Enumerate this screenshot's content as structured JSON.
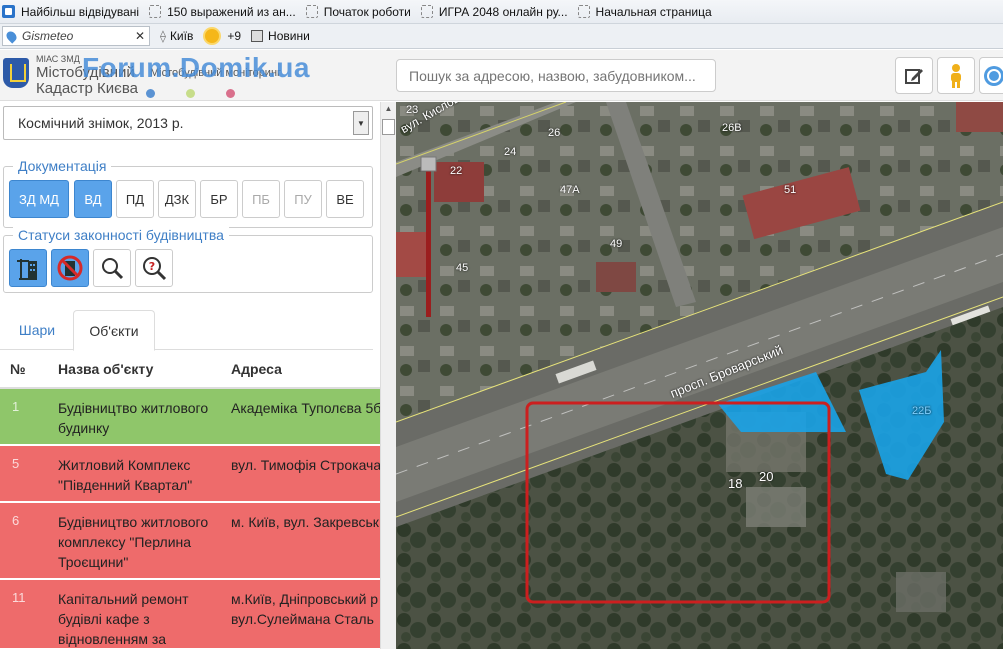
{
  "browser": {
    "bookmarks": [
      "Найбільш відвідувані",
      "150 выражений из ан...",
      "Початок роботи",
      "ИГРА 2048 онлайн ру...",
      "Начальная страница"
    ],
    "gismeteo_label": "Gismeteo",
    "city": "Київ",
    "temperature": "+9",
    "news": "Новини"
  },
  "header": {
    "logo_small": "МІАС ЗМД",
    "logo_line1": "Містобудівний",
    "logo_line2": "Кадастр Києва",
    "logo_sub": "Містобудівний моніторинг",
    "watermark": "Forum.Domik.ua",
    "search_placeholder": "Пошук за адресою, назвою, забудовником...",
    "dot_colors": [
      "#5b93d3",
      "#b9d66a",
      "#d9708c"
    ]
  },
  "layer_select": {
    "value": "Космічний знімок, 2013 р."
  },
  "documentation": {
    "title": "Документація",
    "buttons": [
      {
        "label": "ЗД МД",
        "state": "on"
      },
      {
        "label": "ВД",
        "state": "on"
      },
      {
        "label": "ПД",
        "state": "normal"
      },
      {
        "label": "ДЗК",
        "state": "normal"
      },
      {
        "label": "БР",
        "state": "normal"
      },
      {
        "label": "ПБ",
        "state": "disabled"
      },
      {
        "label": "ПУ",
        "state": "disabled"
      },
      {
        "label": "ВЕ",
        "state": "normal"
      }
    ]
  },
  "statuses": {
    "title": "Статуси законності будівництва",
    "buttons": [
      {
        "icon": "legal-construction-icon",
        "state": "on"
      },
      {
        "icon": "illegal-construction-icon",
        "state": "on"
      },
      {
        "icon": "magnifier-icon",
        "state": "normal"
      },
      {
        "icon": "question-magnifier-icon",
        "state": "normal"
      }
    ]
  },
  "tabs": [
    {
      "label": "Шари",
      "active": false
    },
    {
      "label": "Об'єкти",
      "active": true
    }
  ],
  "table": {
    "headers": [
      "№",
      "Назва об'єкту",
      "Адреса"
    ],
    "rows": [
      {
        "num": "1",
        "name": "Будівництво житлового будинку",
        "address": "Академіка Туполєва 5б",
        "status": "green"
      },
      {
        "num": "5",
        "name": "Житловий Комплекс \"Південний Квартал\"",
        "address": "вул. Тимофія Строкача",
        "status": "red"
      },
      {
        "num": "6",
        "name": "Будівництво житлового комплексу \"Перлина Троєщини\"",
        "address": "м. Київ, вул. Закревськ",
        "status": "red"
      },
      {
        "num": "11",
        "name": "Капітальний ремонт будівлі кафе з відновленням за",
        "address": "м.Київ, Дніпровський р вул.Сулеймана Сталь",
        "status": "red"
      }
    ],
    "colors": {
      "green": "#8fc66a",
      "red": "#ee6b6b"
    }
  },
  "map": {
    "labels": [
      {
        "text": "23"
      },
      {
        "text": "вул. Кисловодська"
      },
      {
        "text": "26"
      },
      {
        "text": "24"
      },
      {
        "text": "26В"
      },
      {
        "text": "22"
      },
      {
        "text": "47А"
      },
      {
        "text": "51"
      },
      {
        "text": "49"
      },
      {
        "text": "45"
      },
      {
        "text": "просп. Броварський"
      },
      {
        "text": "22Б"
      },
      {
        "text": "18"
      },
      {
        "text": "20"
      }
    ],
    "selection_color": "#cc1f1f",
    "parcel_color": "#1aa3e8"
  }
}
